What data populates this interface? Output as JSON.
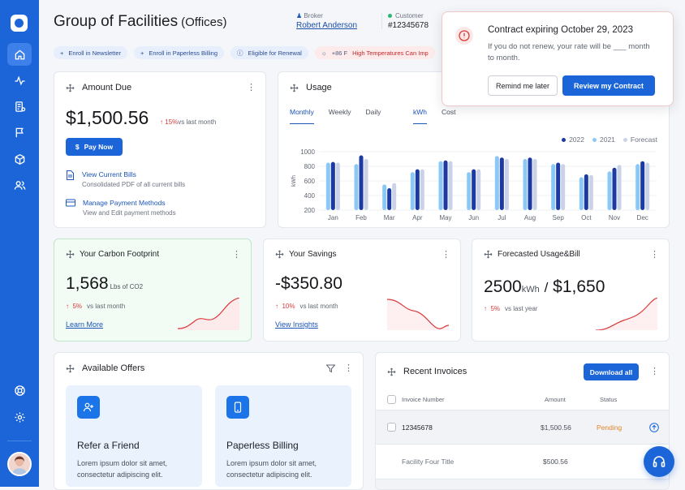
{
  "header": {
    "title": "Group of Facilities",
    "subtitle": "(Offices)",
    "broker_label": "Broker",
    "broker_name": "Robert Anderson",
    "customer_label": "Customer",
    "customer_id": "#12345678"
  },
  "chips": {
    "newsletter": "Enroll in Newsletter",
    "paperless": "Enroll in Paperless Billing",
    "renewal": "Eligible for Renewal",
    "weather_temp": "+86 F",
    "weather_text": "High Temperatures Can Imp"
  },
  "amount_due": {
    "title": "Amount Due",
    "value": "$1,500.56",
    "delta": "15%",
    "delta_suffix": "vs last month",
    "pay_label": "Pay Now",
    "view_bills": "View Current Bills",
    "view_bills_desc": "Consolidated PDF of all current bills",
    "manage_pay": "Manage Payment Methods",
    "manage_pay_desc": "View and Edit payment methods"
  },
  "usage": {
    "title": "Usage",
    "tabs": [
      "Monthly",
      "Weekly",
      "Daily"
    ],
    "unit_tabs": [
      "kWh",
      "Cost"
    ]
  },
  "chart_data": {
    "type": "bar",
    "ylabel": "kWh",
    "ylim": [
      200,
      1000
    ],
    "yticks": [
      200,
      400,
      600,
      800,
      1000
    ],
    "categories": [
      "Jan",
      "Feb",
      "Mar",
      "Apr",
      "May",
      "Jun",
      "Jul",
      "Aug",
      "Sep",
      "Oct",
      "Nov",
      "Dec"
    ],
    "series": [
      {
        "name": "2021",
        "color": "#8cc8f5",
        "values": [
          850,
          830,
          550,
          720,
          870,
          720,
          940,
          900,
          830,
          650,
          730,
          830
        ]
      },
      {
        "name": "2022",
        "color": "#1d3aa3",
        "values": [
          860,
          950,
          500,
          760,
          880,
          760,
          920,
          920,
          850,
          690,
          780,
          870
        ]
      },
      {
        "name": "Forecast",
        "color": "#c9d2e6",
        "values": [
          850,
          900,
          570,
          760,
          870,
          760,
          900,
          900,
          830,
          680,
          820,
          850
        ]
      }
    ],
    "legend_order": [
      "2022",
      "2021",
      "Forecast"
    ],
    "legend_position": "top-right",
    "grid": true
  },
  "carbon": {
    "title": "Your Carbon Footprint",
    "value": "1,568",
    "unit": "Lbs of CO2",
    "delta": "5%",
    "delta_suffix": "vs last month",
    "link": "Learn More"
  },
  "savings": {
    "title": "Your Savings",
    "value": "-$350.80",
    "delta": "10%",
    "delta_suffix": "vs last month",
    "link": "View Insights"
  },
  "forecast": {
    "title": "Forecasted Usage&Bill",
    "value_kwh": "2500",
    "unit": "kWh",
    "sep": "/",
    "value_cost": "$1,650",
    "delta": "5%",
    "delta_suffix": "vs last year"
  },
  "offers": {
    "title": "Available Offers",
    "items": [
      {
        "title": "Refer a Friend",
        "desc": "Lorem ipsum dolor sit amet, consectetur adipiscing elit."
      },
      {
        "title": "Paperless Billing",
        "desc": "Lorem ipsum dolor sit amet, consectetur adipiscing elit."
      }
    ]
  },
  "invoices": {
    "title": "Recent Invoices",
    "download_label": "Download all",
    "columns": [
      "Invoice Number",
      "Amount",
      "Status"
    ],
    "rows": [
      {
        "number": "12345678",
        "amount": "$1,500.56",
        "status": "Pending"
      },
      {
        "number": "Facility Four Title",
        "amount": "$500.56",
        "status": ""
      }
    ]
  },
  "toast": {
    "title": "Contract expiring October 29, 2023",
    "message": "If you do not renew, your rate will be ___ month to month.",
    "remind_label": "Remind me later",
    "review_label": "Review my Contract"
  },
  "colors": {
    "accent": "#1b65d8",
    "danger": "#d93a3a",
    "pending": "#e5852b"
  }
}
